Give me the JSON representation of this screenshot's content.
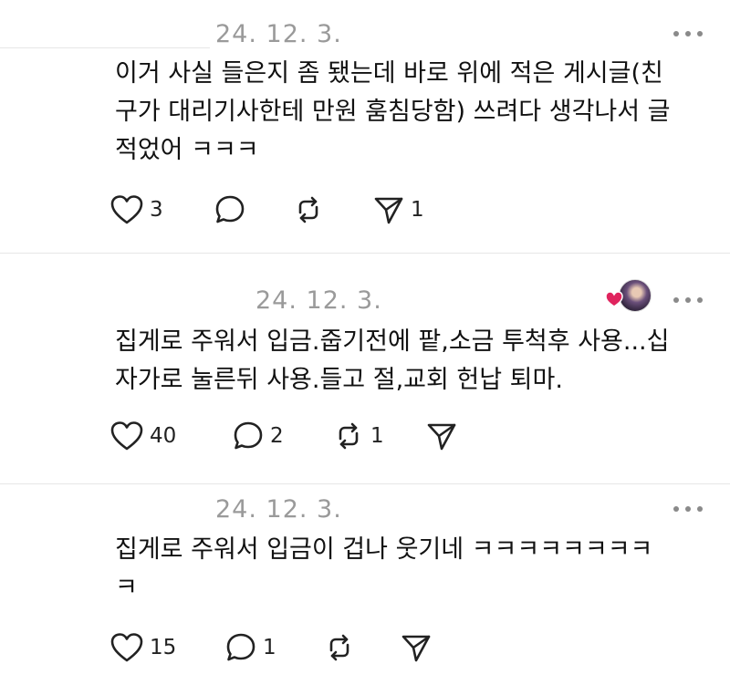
{
  "colors": {
    "date_gray": "#9a9a9a",
    "text": "#111111",
    "icon": "#222222",
    "heart_badge": "#e0245e"
  },
  "posts": [
    {
      "date": "24. 12. 3.",
      "text": "이거 사실 들은지 좀 됐는데 바로 위에 적은 게시글(친\n구가 대리기사한테 만원 훔침당함) 쓰려다 생각나서 글\n적었어 ㅋㅋㅋ",
      "likes": "3",
      "comments": "",
      "reposts": "",
      "shares": "1",
      "icons": [
        "heart-icon",
        "comment-icon",
        "repost-icon",
        "share-icon",
        "more-icon"
      ]
    },
    {
      "date": "24. 12. 3.",
      "text": "집게로 주워서 입금.줍기전에 팥,소금 투척후 사용...십\n자가로 눌른뒤 사용.들고 절,교회 헌납 퇴마.",
      "likes": "40",
      "comments": "2",
      "reposts": "1",
      "shares": "",
      "has_avatar": true,
      "icons": [
        "heart-icon",
        "comment-icon",
        "repost-icon",
        "share-icon",
        "more-icon",
        "avatar",
        "liked-heart-icon"
      ]
    },
    {
      "date": "24. 12. 3.",
      "text": "집게로 주워서 입금이 겁나 웃기네 ㅋㅋㅋㅋㅋㅋㅋㅋ\nㅋ",
      "likes": "15",
      "comments": "1",
      "reposts": "",
      "shares": "",
      "icons": [
        "heart-icon",
        "comment-icon",
        "repost-icon",
        "share-icon",
        "more-icon"
      ]
    }
  ]
}
